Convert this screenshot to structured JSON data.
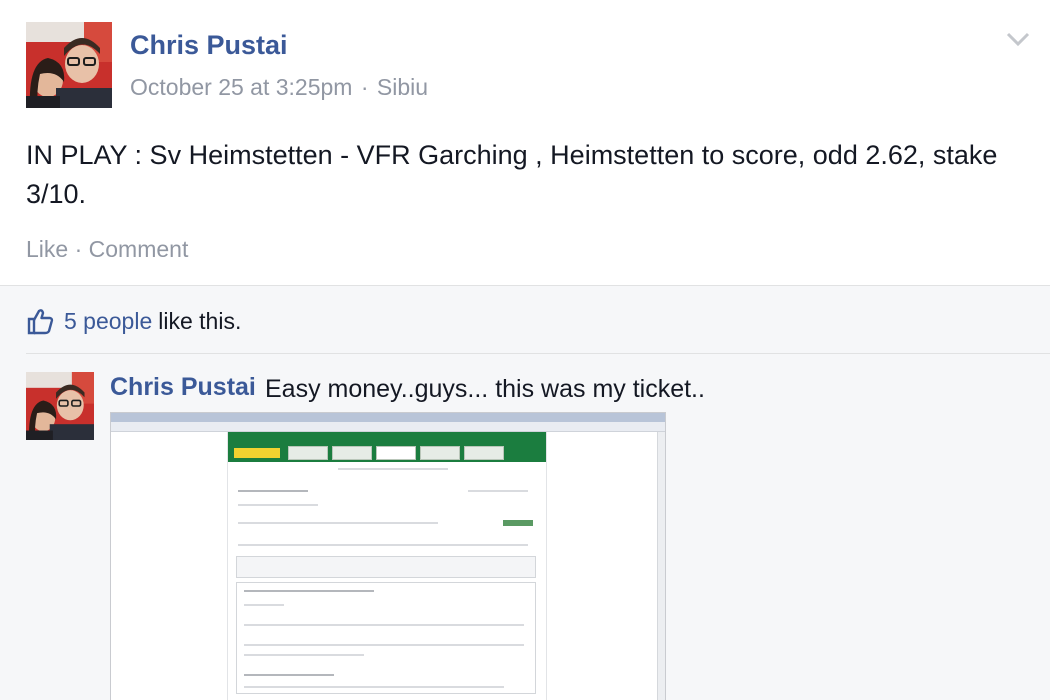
{
  "post": {
    "author": "Chris Pustai",
    "date": "October 25 at 3:25pm",
    "separator": "·",
    "location": "Sibiu",
    "text": "IN PLAY : Sv Heimstetten - VFR Garching , Heimstetten to score, odd 2.62, stake 3/10.",
    "actions": {
      "like": "Like",
      "separator": "·",
      "comment": "Comment"
    }
  },
  "feedback": {
    "likes_link": "5 people",
    "likes_suffix": "like this.",
    "comment": {
      "author": "Chris Pustai",
      "text": "Easy money..guys... this was my ticket..",
      "attachment_icon": "screenshot-image"
    }
  },
  "colors": {
    "link": "#3b5998",
    "meta": "#9197a3",
    "feedback_bg": "#f6f7f9",
    "avatar_bg": "#c8302c",
    "screenshot_header": "#1b7d3f"
  },
  "icons": {
    "chevron": "chevron-down-icon",
    "like": "thumbs-up-icon"
  }
}
